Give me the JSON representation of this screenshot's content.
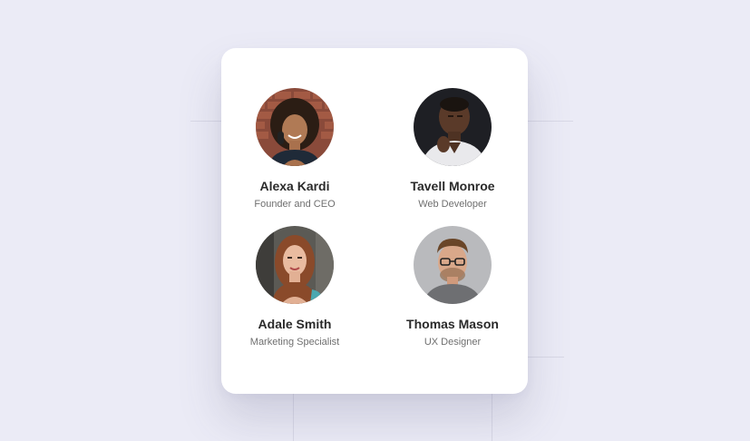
{
  "team": {
    "members": [
      {
        "name": "Alexa Kardi",
        "role": "Founder and CEO"
      },
      {
        "name": "Tavell Monroe",
        "role": "Web Developer"
      },
      {
        "name": "Adale Smith",
        "role": "Marketing Specialist"
      },
      {
        "name": "Thomas Mason",
        "role": "UX Designer"
      }
    ]
  },
  "colors": {
    "background": "#ebebf6",
    "card": "#ffffff",
    "name_text": "#2a2a2a",
    "role_text": "#6f6f6f"
  }
}
